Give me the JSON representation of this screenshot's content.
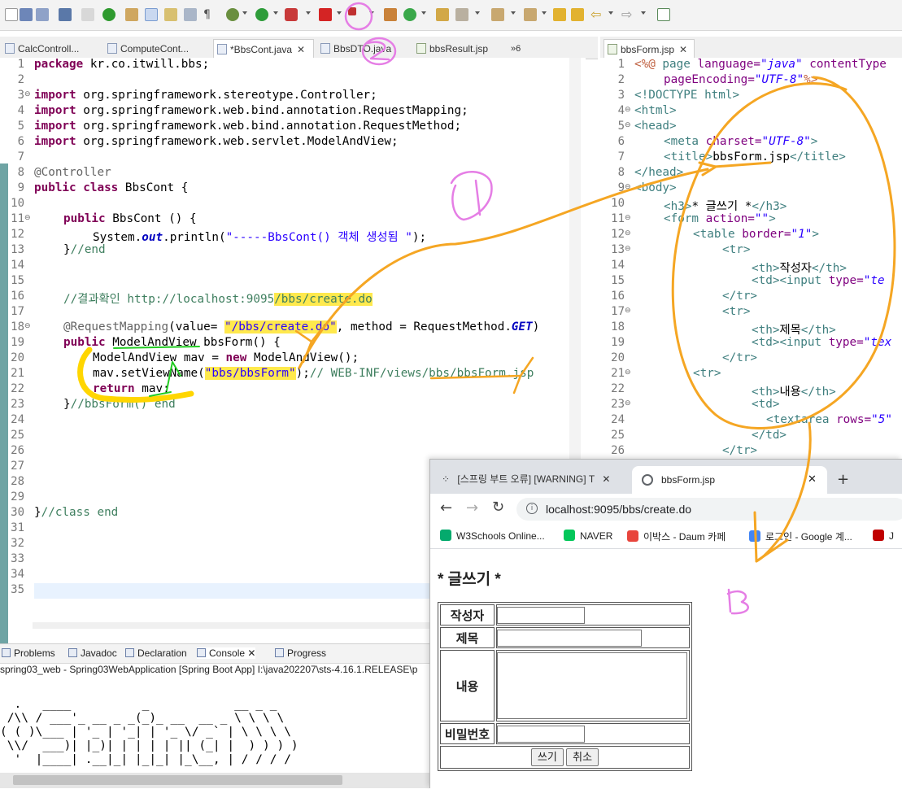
{
  "eclipse": {
    "editor_tabs": [
      {
        "label": "CalcControll...",
        "active": false,
        "closable": false
      },
      {
        "label": "ComputeCont...",
        "active": false,
        "closable": false
      },
      {
        "label": "*BbsCont.java",
        "active": true,
        "closable": true
      },
      {
        "label": "BbsDTO.java",
        "active": false,
        "closable": false
      },
      {
        "label": "bbsResult.jsp",
        "active": false,
        "closable": false
      }
    ],
    "tabs_overflow": "»6",
    "right_tab": {
      "label": "bbsForm.jsp",
      "closable": true
    },
    "bottom_tabs": [
      {
        "label": "Problems",
        "icon": "problems-icon"
      },
      {
        "label": "Javadoc",
        "icon": "javadoc-icon"
      },
      {
        "label": "Declaration",
        "icon": "declaration-icon"
      },
      {
        "label": "Console",
        "icon": "console-icon",
        "active": true
      },
      {
        "label": "Progress",
        "icon": "progress-icon"
      }
    ],
    "console_title": "spring03_web - Spring03WebApplication [Spring Boot App] I:\\java202207\\sts-4.16.1.RELEASE\\p",
    "console_banner": [
      "  .   ____          _            __ _ _",
      " /\\\\ / ___'_ __ _ _(_)_ __  __ _ \\ \\ \\ \\",
      "( ( )\\___ | '_ | '_| | '_ \\/ _` | \\ \\ \\ \\",
      " \\\\/  ___)| |_)| | | | | || (_| |  ) ) ) )",
      "  '  |____| .__|_| |_|_| |_\\__, | / / / /"
    ]
  },
  "java_lines": [
    {
      "n": "1",
      "fold": ""
    },
    {
      "n": "2",
      "fold": ""
    },
    {
      "n": "3",
      "fold": "⊖"
    },
    {
      "n": "4",
      "fold": ""
    },
    {
      "n": "5",
      "fold": ""
    },
    {
      "n": "6",
      "fold": ""
    },
    {
      "n": "7",
      "fold": ""
    },
    {
      "n": "8",
      "fold": ""
    },
    {
      "n": "9",
      "fold": ""
    },
    {
      "n": "10",
      "fold": ""
    },
    {
      "n": "11",
      "fold": "⊖"
    },
    {
      "n": "12",
      "fold": ""
    },
    {
      "n": "13",
      "fold": ""
    },
    {
      "n": "14",
      "fold": ""
    },
    {
      "n": "15",
      "fold": ""
    },
    {
      "n": "16",
      "fold": ""
    },
    {
      "n": "17",
      "fold": ""
    },
    {
      "n": "18",
      "fold": "⊖"
    },
    {
      "n": "19",
      "fold": ""
    },
    {
      "n": "20",
      "fold": ""
    },
    {
      "n": "21",
      "fold": ""
    },
    {
      "n": "22",
      "fold": ""
    },
    {
      "n": "23",
      "fold": ""
    },
    {
      "n": "24",
      "fold": ""
    },
    {
      "n": "25",
      "fold": ""
    },
    {
      "n": "26",
      "fold": ""
    },
    {
      "n": "27",
      "fold": ""
    },
    {
      "n": "28",
      "fold": ""
    },
    {
      "n": "29",
      "fold": ""
    },
    {
      "n": "30",
      "fold": ""
    },
    {
      "n": "31",
      "fold": ""
    },
    {
      "n": "32",
      "fold": ""
    },
    {
      "n": "33",
      "fold": ""
    },
    {
      "n": "34",
      "fold": ""
    },
    {
      "n": "35",
      "fold": ""
    }
  ],
  "jsp_lines": [
    {
      "n": "1",
      "fold": ""
    },
    {
      "n": "2",
      "fold": ""
    },
    {
      "n": "3",
      "fold": ""
    },
    {
      "n": "4",
      "fold": "⊖"
    },
    {
      "n": "5",
      "fold": "⊖"
    },
    {
      "n": "6",
      "fold": ""
    },
    {
      "n": "7",
      "fold": ""
    },
    {
      "n": "8",
      "fold": ""
    },
    {
      "n": "9",
      "fold": "⊖"
    },
    {
      "n": "10",
      "fold": ""
    },
    {
      "n": "11",
      "fold": "⊖"
    },
    {
      "n": "12",
      "fold": "⊖"
    },
    {
      "n": "13",
      "fold": "⊖"
    },
    {
      "n": "14",
      "fold": ""
    },
    {
      "n": "15",
      "fold": ""
    },
    {
      "n": "16",
      "fold": ""
    },
    {
      "n": "17",
      "fold": "⊖"
    },
    {
      "n": "18",
      "fold": ""
    },
    {
      "n": "19",
      "fold": ""
    },
    {
      "n": "20",
      "fold": ""
    },
    {
      "n": "21",
      "fold": "⊖"
    },
    {
      "n": "22",
      "fold": ""
    },
    {
      "n": "23",
      "fold": "⊖"
    },
    {
      "n": "24",
      "fold": ""
    },
    {
      "n": "25",
      "fold": ""
    },
    {
      "n": "26",
      "fold": ""
    }
  ],
  "java_code": {
    "l1_kw": "package",
    "l1_rest": " kr.co.itwill.bbs;",
    "import_kw": "import",
    "imp3": " org.springframework.stereotype.Controller;",
    "imp4": " org.springframework.web.bind.annotation.RequestMapping;",
    "imp5": " org.springframework.web.bind.annotation.RequestMethod;",
    "imp6": " org.springframework.web.servlet.ModelAndView;",
    "l8": "@Controller",
    "l9_kw": "public class",
    "l9_rest": " BbsCont {",
    "l11_kw": "public",
    "l11_rest": " BbsCont () {",
    "l12_a": "System.",
    "l12_fld": "out",
    "l12_b": ".println(",
    "l12_str": "\"-----BbsCont() 객체 생성됨 \"",
    "l12_c": ");",
    "l13_a": "}",
    "l13_cmt": "//end",
    "l16_cmt_a": "//결과확인 http://localhost:9095",
    "l16_cmt_hl": "/bbs/create.do",
    "l18_ann": "@RequestMapping",
    "l18_a": "(value= ",
    "l18_str": "\"/bbs/create.do\"",
    "l18_b": ", method = RequestMethod.",
    "l18_fld": "GET",
    "l18_c": ")",
    "l19_kw": "public",
    "l19_rest": " ModelAndView bbsForm() {",
    "l20_a": "ModelAndView mav = ",
    "l20_kw": "new",
    "l20_b": " ModelAndView();",
    "l21_a": "mav.setViewName(",
    "l21_str": "\"bbs/bbsForm\"",
    "l21_b": ");",
    "l21_cmt": "// WEB-INF/views/bbs/bbsForm.jsp",
    "l22_kw": "return",
    "l22_rest": " mav;",
    "l23_a": "}",
    "l23_cmt": "//bbsForm() end",
    "l30_a": "}",
    "l30_cmt": "//class end"
  },
  "jsp_code": {
    "l1_jsp": "<%@",
    "l1_a": " page ",
    "l1_attr": "language=",
    "l1_val": "\"java\"",
    "l1_attr2": " contentType",
    "l2_attr": "pageEncoding=",
    "l2_val": "\"UTF-8\"",
    "l2_jsp": "%>",
    "l3": "<!DOCTYPE html>",
    "l4": "<html>",
    "l5": "<head>",
    "l6_tag": "<meta ",
    "l6_attr": "charset=",
    "l6_val": "\"UTF-8\"",
    "l6_end": ">",
    "l7_tag": "<title>",
    "l7_text": "bbsForm.jsp",
    "l7_end": "</title>",
    "l8": "</head>",
    "l9": "<body>",
    "l10_tag": "<h3>",
    "l10_text": "* 글쓰기 *",
    "l10_end": "</h3>",
    "l11_tag": "<form ",
    "l11_attr": "action=",
    "l11_val": "\"\"",
    "l11_end": ">",
    "l12_tag": "<table ",
    "l12_attr": "border=",
    "l12_val": "\"1\"",
    "l12_end": ">",
    "tr_open": "<tr>",
    "tr_close": "</tr>",
    "td_open": "<td>",
    "td_close": "</td>",
    "th_open": "<th>",
    "th_close": "</th>",
    "l14_text": "작성자",
    "l18_text": "제목",
    "l22_text": "내용",
    "input_tag": "<input ",
    "input_attr": "type=",
    "input_val_15": "\"te",
    "input_val_19": "\"tex",
    "l24_tag": "<textarea ",
    "l24_attr": "rows=",
    "l24_val": "\"5\""
  },
  "browser": {
    "tabs": [
      {
        "label": "[스프링 부트 오류] [WARNING] T",
        "active": false,
        "icon": "tistory-icon"
      },
      {
        "label": "bbsForm.jsp",
        "active": true,
        "icon": "globe-icon"
      }
    ],
    "new_tab": "+",
    "url": "localhost:9095/bbs/create.do",
    "bookmarks": [
      {
        "label": "W3Schools Online...",
        "icon": "w3schools-icon",
        "color": "#04aa6d"
      },
      {
        "label": "NAVER",
        "icon": "naver-icon",
        "color": "#03c75a"
      },
      {
        "label": "이박스 - Daum 카페",
        "icon": "daum-icon",
        "color": "#e8453c"
      },
      {
        "label": "로그인 - Google 계...",
        "icon": "google-icon",
        "color": "#4285f4"
      },
      {
        "label": "J",
        "icon": "bookmark-icon",
        "color": "#c00000"
      }
    ],
    "page": {
      "heading": "* 글쓰기 *",
      "rows": [
        {
          "label": "작성자",
          "type": "text"
        },
        {
          "label": "제목",
          "type": "text"
        },
        {
          "label": "내용",
          "type": "textarea"
        },
        {
          "label": "비밀번호",
          "type": "password"
        }
      ],
      "submit_label": "쓰기",
      "cancel_label": "취소"
    }
  },
  "annotations": {
    "marks": [
      "1",
      "2",
      "3"
    ],
    "orange": "#f5a623",
    "pink": "#e57ee5",
    "yellow": "#ffd600",
    "green": "#22cc22"
  }
}
